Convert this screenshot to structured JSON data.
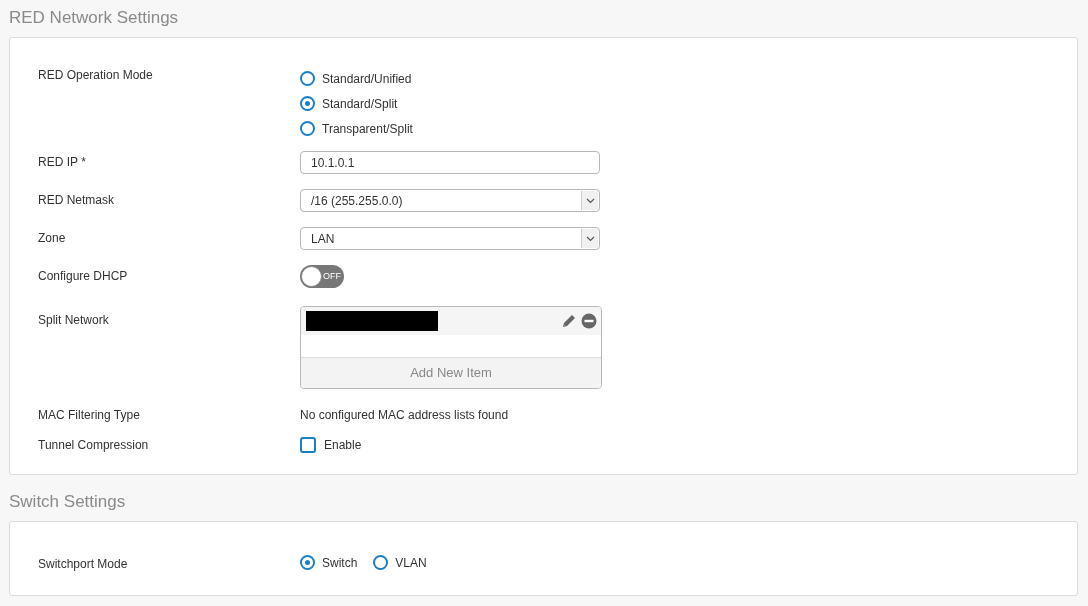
{
  "sections": [
    {
      "title": "RED Network Settings",
      "rows": [
        {
          "kind": "radio_list",
          "label": "RED Operation Mode",
          "options": [
            {
              "label": "Standard/Unified",
              "selected": false
            },
            {
              "label": "Standard/Split",
              "selected": true
            },
            {
              "label": "Transparent/Split",
              "selected": false
            }
          ]
        },
        {
          "kind": "text",
          "label": "RED IP *",
          "value": "10.1.0.1"
        },
        {
          "kind": "select",
          "label": "RED Netmask",
          "value": "/16 (255.255.0.0)"
        },
        {
          "kind": "select",
          "label": "Zone",
          "value": "LAN"
        },
        {
          "kind": "toggle",
          "label": "Configure DHCP",
          "on": false,
          "state_text": "OFF"
        },
        {
          "kind": "list",
          "label": "Split Network",
          "items": [
            {
              "redacted": true
            }
          ],
          "add_label": "Add New Item"
        },
        {
          "kind": "static",
          "label": "MAC Filtering Type",
          "value": "No configured MAC address lists found"
        },
        {
          "kind": "checkbox",
          "label": "Tunnel Compression",
          "checked": false,
          "option": "Enable"
        }
      ]
    },
    {
      "title": "Switch Settings",
      "rows": [
        {
          "kind": "radio_row",
          "label": "Switchport Mode",
          "options": [
            {
              "label": "Switch",
              "selected": true
            },
            {
              "label": "VLAN",
              "selected": false
            }
          ]
        }
      ]
    }
  ]
}
